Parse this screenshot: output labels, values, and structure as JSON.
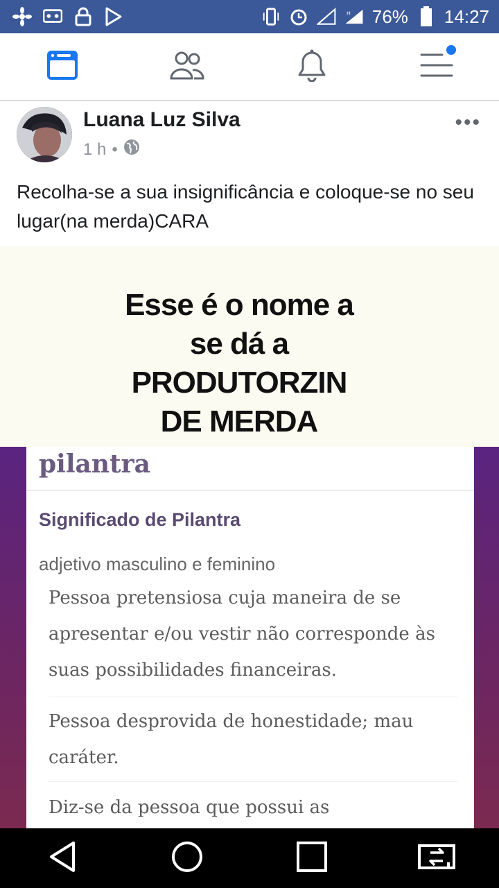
{
  "status_bar": {
    "battery": "76%",
    "time": "14:27",
    "icons": [
      "flower-icon",
      "voicemail-icon",
      "lock-icon",
      "play-store-icon",
      "vibrate-icon",
      "alarm-icon",
      "signal-icon",
      "h-signal-icon",
      "battery-icon"
    ]
  },
  "tabs": [
    {
      "name": "news-feed",
      "icon": "news-feed-icon",
      "active": true
    },
    {
      "name": "friends",
      "icon": "friends-icon",
      "active": false
    },
    {
      "name": "notifications",
      "icon": "bell-icon",
      "active": false
    },
    {
      "name": "menu",
      "icon": "menu-icon",
      "active": false,
      "badge": true
    }
  ],
  "post": {
    "author": "Luana Luz Silva",
    "time": "1 h",
    "separator": "•",
    "privacy_icon": "globe-icon",
    "text": "Recolha-se a sua insignificância e coloque-se no seu lugar(na merda)CARA",
    "image": {
      "caption_lines": [
        "Esse é o nome a",
        "se dá a",
        "PRODUTORZIN",
        "DE MERDA"
      ],
      "dictionary": {
        "word": "pilantra",
        "heading": "Significado de Pilantra",
        "word_class": "adjetivo masculino e feminino",
        "definitions": [
          "Pessoa pretensiosa cuja maneira de se apresentar e/ou vestir não corresponde às suas possibilidades financeiras.",
          "Pessoa desprovida de honestidade; mau caráter.",
          "Diz-se da pessoa que possui as"
        ]
      }
    }
  },
  "colors": {
    "status_bar": "#3b5998",
    "accent": "#1877f2",
    "image_frame": "#6a2566"
  }
}
